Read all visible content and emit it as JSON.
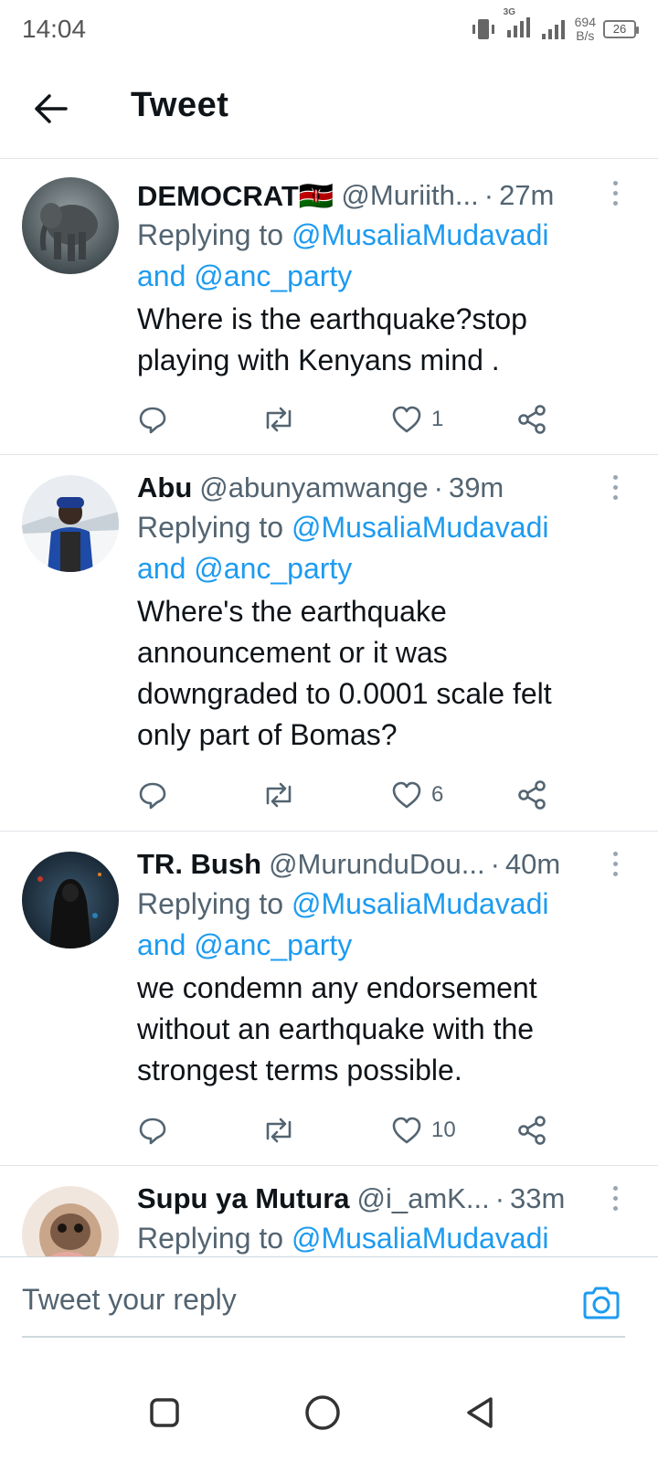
{
  "status_bar": {
    "time": "14:04",
    "net_speed_value": "694",
    "net_speed_unit": "B/s",
    "battery": "26",
    "network_type": "3G"
  },
  "header": {
    "title": "Tweet",
    "back_icon": "arrow-left-icon"
  },
  "tweets": [
    {
      "name": "DEMOCRAT🇰🇪",
      "handle": "@Muriith...",
      "time": "27m",
      "replying_prefix": "Replying to ",
      "mention1": "@MusaliaMudavadi",
      "conj": "and ",
      "mention2": "@anc_party",
      "text_lines": [
        "Where is the earthquake?stop",
        "playing with Kenyans mind ."
      ],
      "likes": "1"
    },
    {
      "name": "Abu",
      "handle": "@abunyamwange",
      "time": "39m",
      "replying_prefix": "Replying to ",
      "mention1": "@MusaliaMudavadi",
      "conj": "and ",
      "mention2": "@anc_party",
      "text_lines": [
        "Where's the earthquake",
        "announcement or it was",
        "downgraded to 0.0001 scale felt",
        "only part of Bomas?"
      ],
      "likes": "6"
    },
    {
      "name": "TR. Bush",
      "handle": "@MurunduDou...",
      "time": "40m",
      "replying_prefix": "Replying to ",
      "mention1": "@MusaliaMudavadi",
      "conj": "and ",
      "mention2": "@anc_party",
      "text_lines": [
        "we condemn any endorsement",
        "without an earthquake with the",
        "strongest terms possible."
      ],
      "likes": "10"
    },
    {
      "name": "Supu ya Mutura",
      "handle": "@i_amK...",
      "time": "33m",
      "replying_prefix": "Replying to ",
      "mention1": "@MusaliaMudavadi"
    }
  ],
  "reply_bar": {
    "placeholder": "Tweet your reply",
    "camera_icon": "camera-icon"
  },
  "nav": {
    "items": [
      "square-icon",
      "circle-icon",
      "triangle-back-icon"
    ]
  },
  "colors": {
    "accent": "#1d9bf0",
    "secondary_text": "#536471",
    "divider": "#e1e4e8"
  }
}
